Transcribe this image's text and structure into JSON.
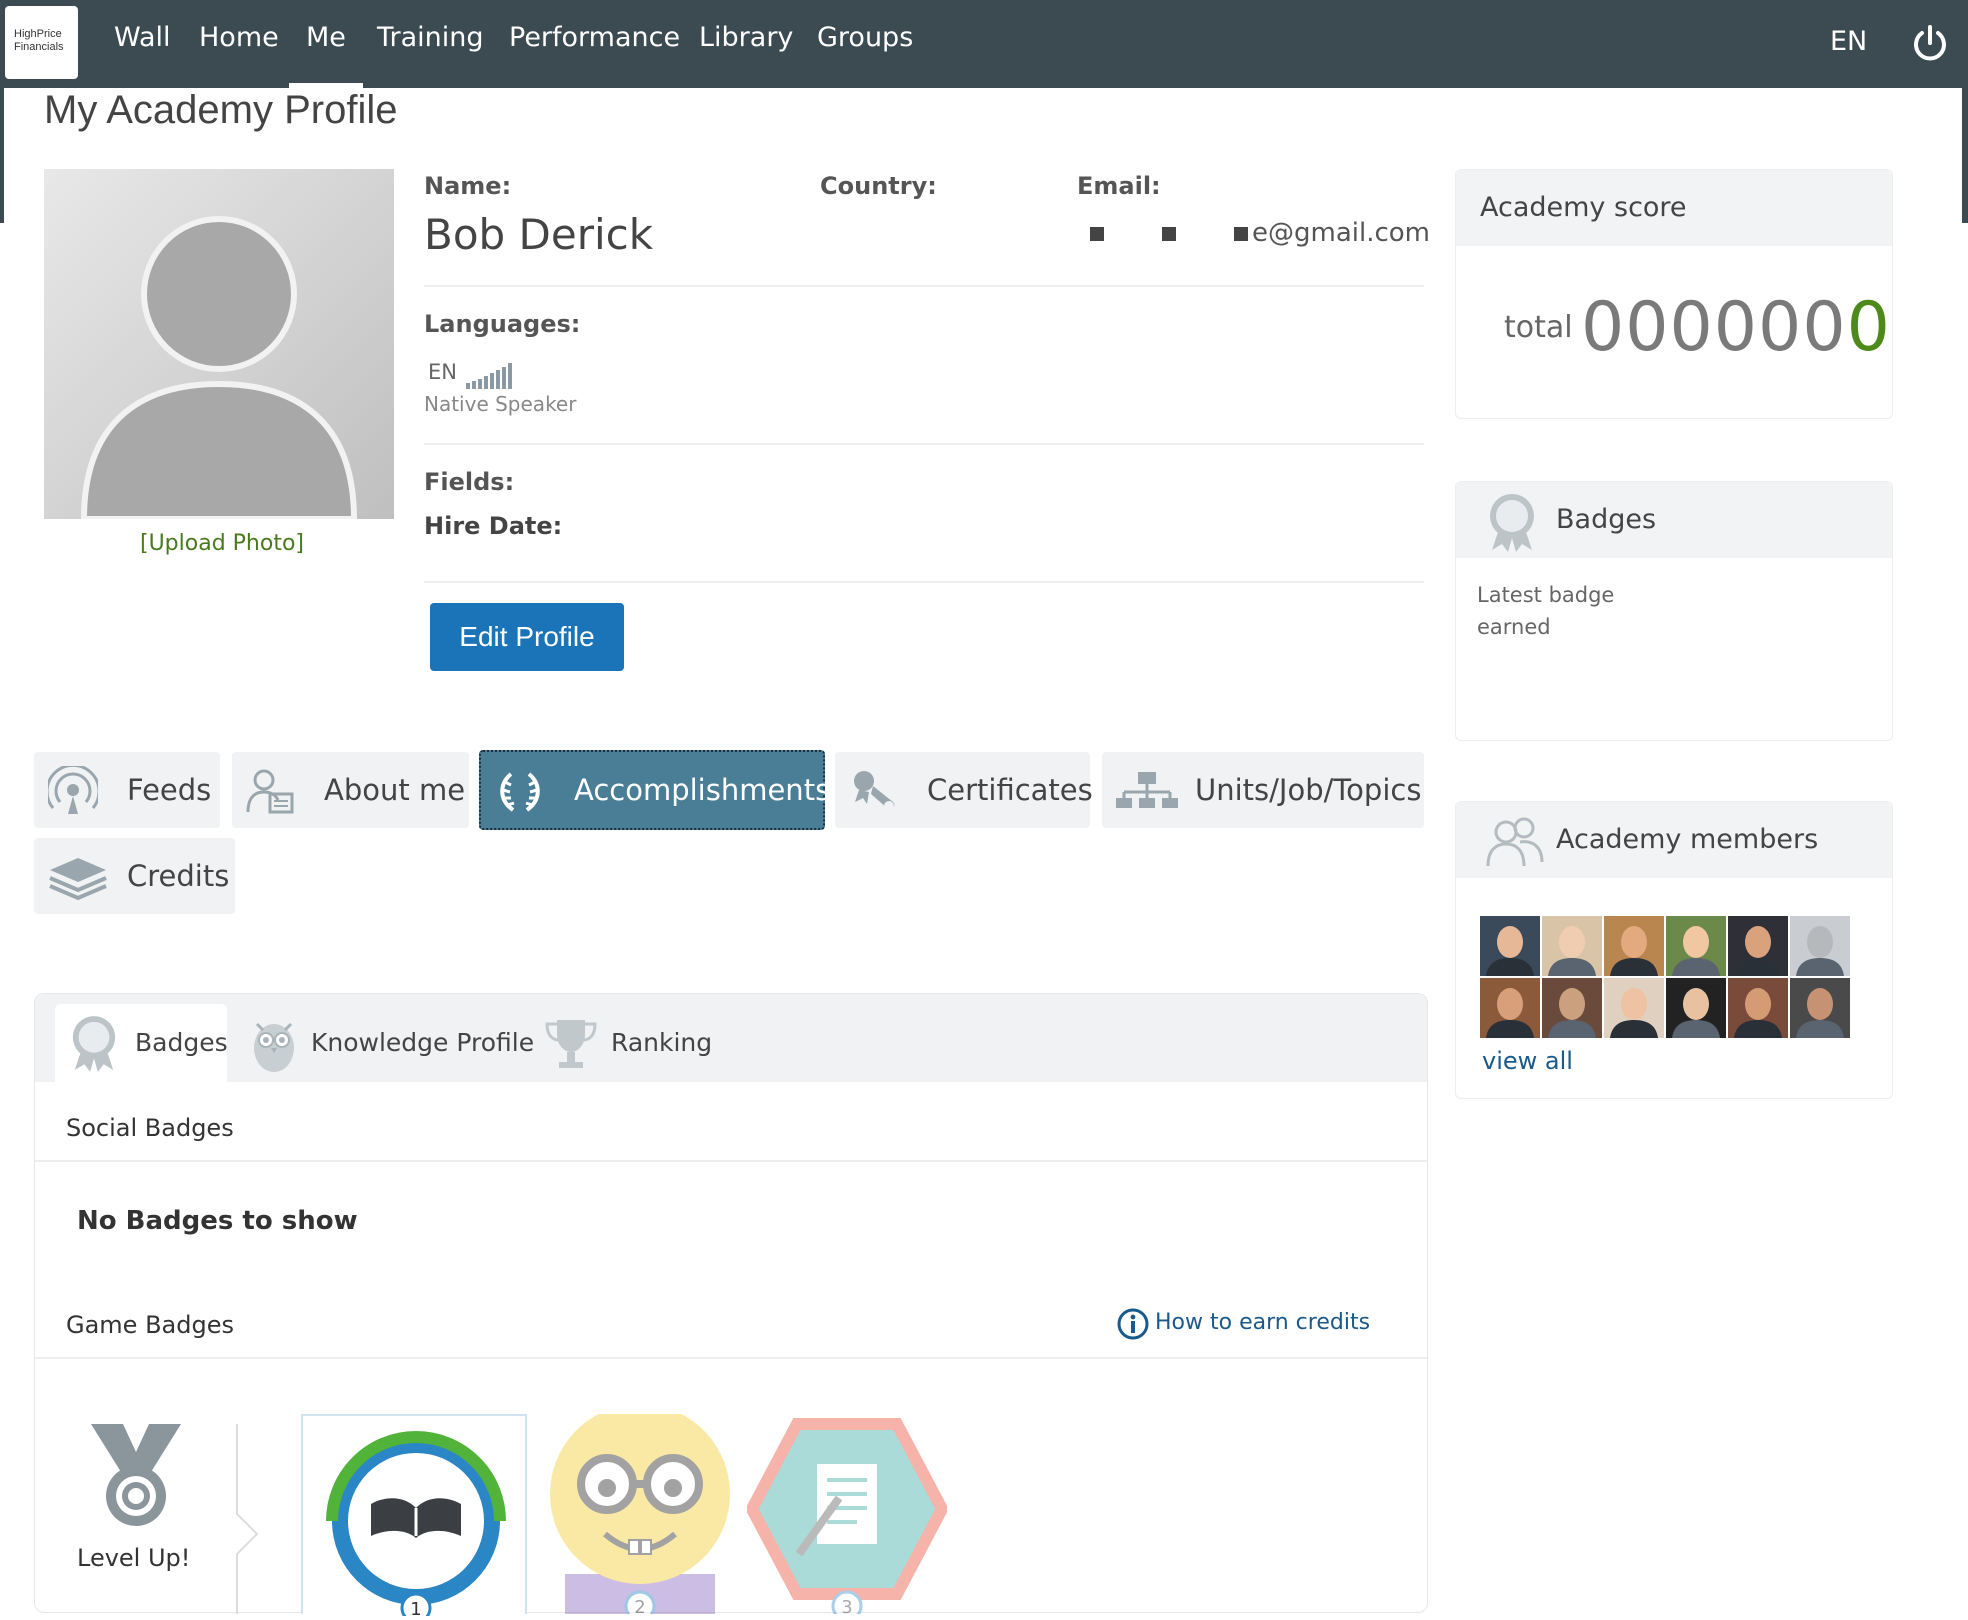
{
  "app": {
    "logo_line1": "HighPrice",
    "logo_line2": "Financials"
  },
  "nav": {
    "items": [
      {
        "label": "Wall"
      },
      {
        "label": "Home"
      },
      {
        "label": "Me"
      },
      {
        "label": "Training"
      },
      {
        "label": "Performance"
      },
      {
        "label": "Library"
      },
      {
        "label": "Groups"
      }
    ],
    "active": "Me",
    "language": "EN"
  },
  "page": {
    "title": "My Academy Profile"
  },
  "profile": {
    "upload_photo": "[Upload Photo]",
    "name_label": "Name:",
    "name": "Bob Derick",
    "country_label": "Country:",
    "email_label": "Email:",
    "email_visible": "e@gmail.com",
    "languages_label": "Languages:",
    "language_code": "EN",
    "language_level": "Native Speaker",
    "fields_label": "Fields:",
    "hire_date_label": "Hire Date:",
    "edit_button": "Edit Profile"
  },
  "tabs": [
    {
      "label": "Feeds",
      "icon": "feeds-icon"
    },
    {
      "label": "About me",
      "icon": "about-me-icon"
    },
    {
      "label": "Accomplishments",
      "icon": "laurel-icon",
      "active": true
    },
    {
      "label": "Certificates",
      "icon": "certificate-icon"
    },
    {
      "label": "Units/Job/Topics",
      "icon": "org-chart-icon"
    },
    {
      "label": "Credits",
      "icon": "stack-icon"
    }
  ],
  "subtabs": [
    {
      "label": "Badges",
      "active": true
    },
    {
      "label": "Knowledge Profile"
    },
    {
      "label": "Ranking"
    }
  ],
  "badges_section": {
    "social_title": "Social Badges",
    "no_badges": "No Badges to show",
    "game_title": "Game Badges",
    "how_to": "How to earn credits",
    "level_up": "Level Up!",
    "game_badges": [
      {
        "number": "1",
        "icon": "open-book-icon"
      },
      {
        "number": "2",
        "icon": "nerd-face-icon"
      },
      {
        "number": "3",
        "icon": "document-pen-icon"
      }
    ]
  },
  "score_panel": {
    "title": "Academy score",
    "total_label": "total",
    "digits_main": "000000",
    "digits_last": "0",
    "accent": "#4e8a1a"
  },
  "badges_panel": {
    "title": "Badges",
    "latest_line1": "Latest badge",
    "latest_line2": "earned"
  },
  "members_panel": {
    "title": "Academy members",
    "view_all": "view all",
    "count": 12
  }
}
